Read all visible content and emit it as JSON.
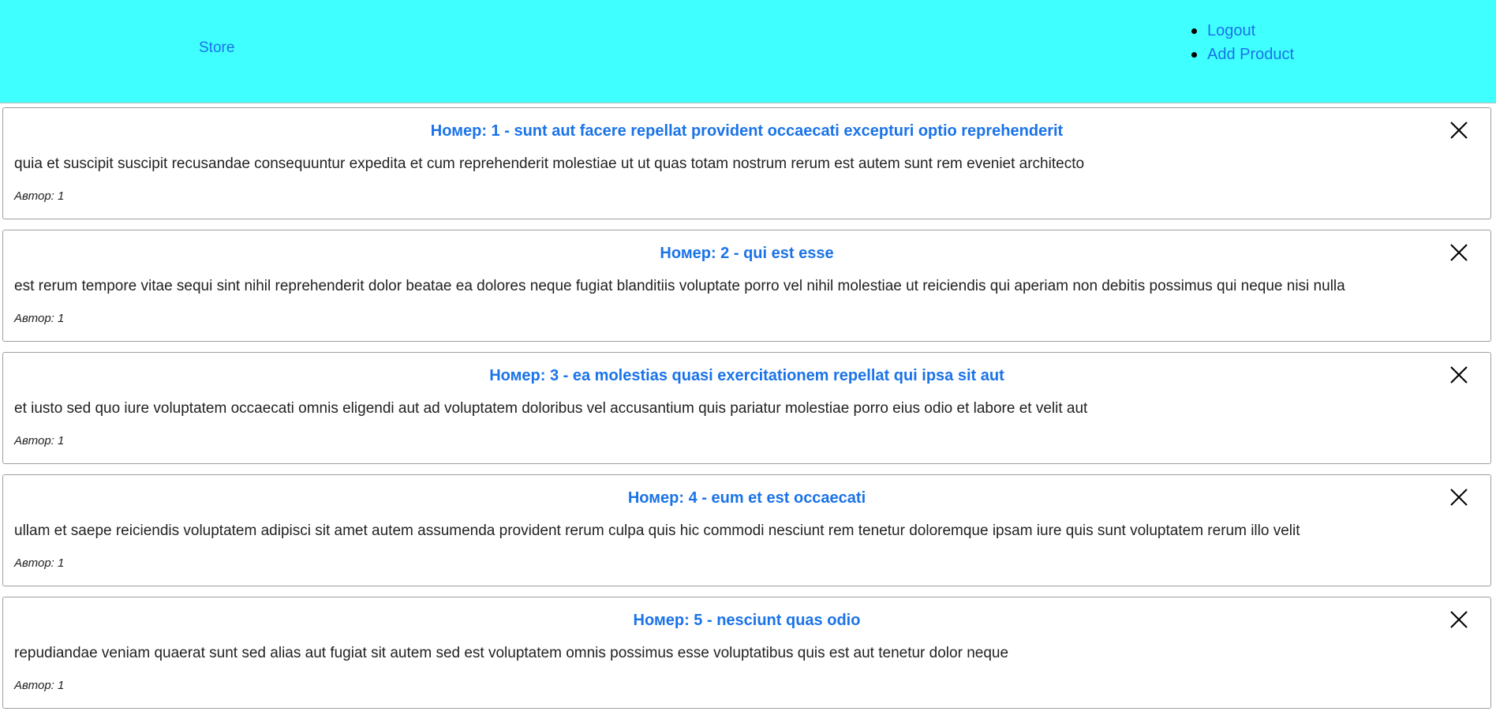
{
  "header": {
    "brand": "Store",
    "nav": [
      "Logout",
      "Add Product"
    ]
  },
  "posts": [
    {
      "title": "Номер: 1 - sunt aut facere repellat provident occaecati excepturi optio reprehenderit",
      "body": "quia et suscipit suscipit recusandae consequuntur expedita et cum reprehenderit molestiae ut ut quas totam nostrum rerum est autem sunt rem eveniet architecto",
      "author": "Автор: 1"
    },
    {
      "title": "Номер: 2 - qui est esse",
      "body": "est rerum tempore vitae sequi sint nihil reprehenderit dolor beatae ea dolores neque fugiat blanditiis voluptate porro vel nihil molestiae ut reiciendis qui aperiam non debitis possimus qui neque nisi nulla",
      "author": "Автор: 1"
    },
    {
      "title": "Номер: 3 - ea molestias quasi exercitationem repellat qui ipsa sit aut",
      "body": "et iusto sed quo iure voluptatem occaecati omnis eligendi aut ad voluptatem doloribus vel accusantium quis pariatur molestiae porro eius odio et labore et velit aut",
      "author": "Автор: 1"
    },
    {
      "title": "Номер: 4 - eum et est occaecati",
      "body": "ullam et saepe reiciendis voluptatem adipisci sit amet autem assumenda provident rerum culpa quis hic commodi nesciunt rem tenetur doloremque ipsam iure quis sunt voluptatem rerum illo velit",
      "author": "Автор: 1"
    },
    {
      "title": "Номер: 5 - nesciunt quas odio",
      "body": "repudiandae veniam quaerat sunt sed alias aut fugiat sit autem sed est voluptatem omnis possimus esse voluptatibus quis est aut tenetur dolor neque",
      "author": "Автор: 1"
    }
  ],
  "icons": {
    "close": "close-icon"
  },
  "colors": {
    "header_bg": "#40ffff",
    "link": "#1a73e8",
    "text": "#222222",
    "card_border": "#9e9e9e"
  }
}
